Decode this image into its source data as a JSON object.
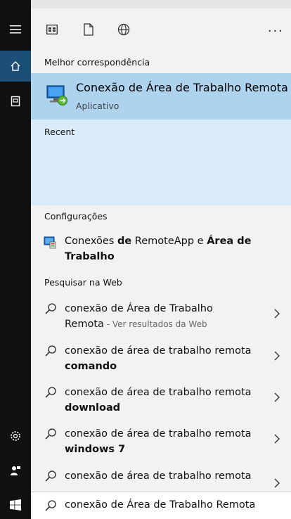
{
  "toolbar": {
    "icons": [
      "apps-icon",
      "document-icon",
      "globe-icon"
    ],
    "more_label": "..."
  },
  "best_match": {
    "heading": "Melhor correspondência",
    "title": "Conexão de Área de Trabalho Remota",
    "subtitle": "Aplicativo"
  },
  "recent": {
    "heading": "Recent"
  },
  "settings": {
    "heading": "Configurações",
    "item": {
      "part1": "Conexões ",
      "part2": "de",
      "part3": " RemoteApp e ",
      "part4": "Área de",
      "part5": "Trabalho"
    }
  },
  "web": {
    "heading": "Pesquisar na Web",
    "items": [
      {
        "line1": "conexão de Área de Trabalho",
        "line2": "Remota",
        "suffix": " - Ver resultados da Web"
      },
      {
        "line1": "conexão de área de trabalho remota",
        "line2": "comando"
      },
      {
        "line1": "conexão de área de trabalho remota",
        "line2": "download"
      },
      {
        "line1": "conexão de área de trabalho remota",
        "line2": "windows 7"
      },
      {
        "line1": "conexão de área de trabalho remota",
        "line2": ""
      }
    ]
  },
  "search": {
    "value": "conexão de Área de Trabalho Remota"
  },
  "colors": {
    "rail": "#101010",
    "active": "#1c4f76",
    "highlight": "#aed3ee",
    "recent_bg": "#d9ebf8",
    "panel": "#f2f2f2"
  }
}
